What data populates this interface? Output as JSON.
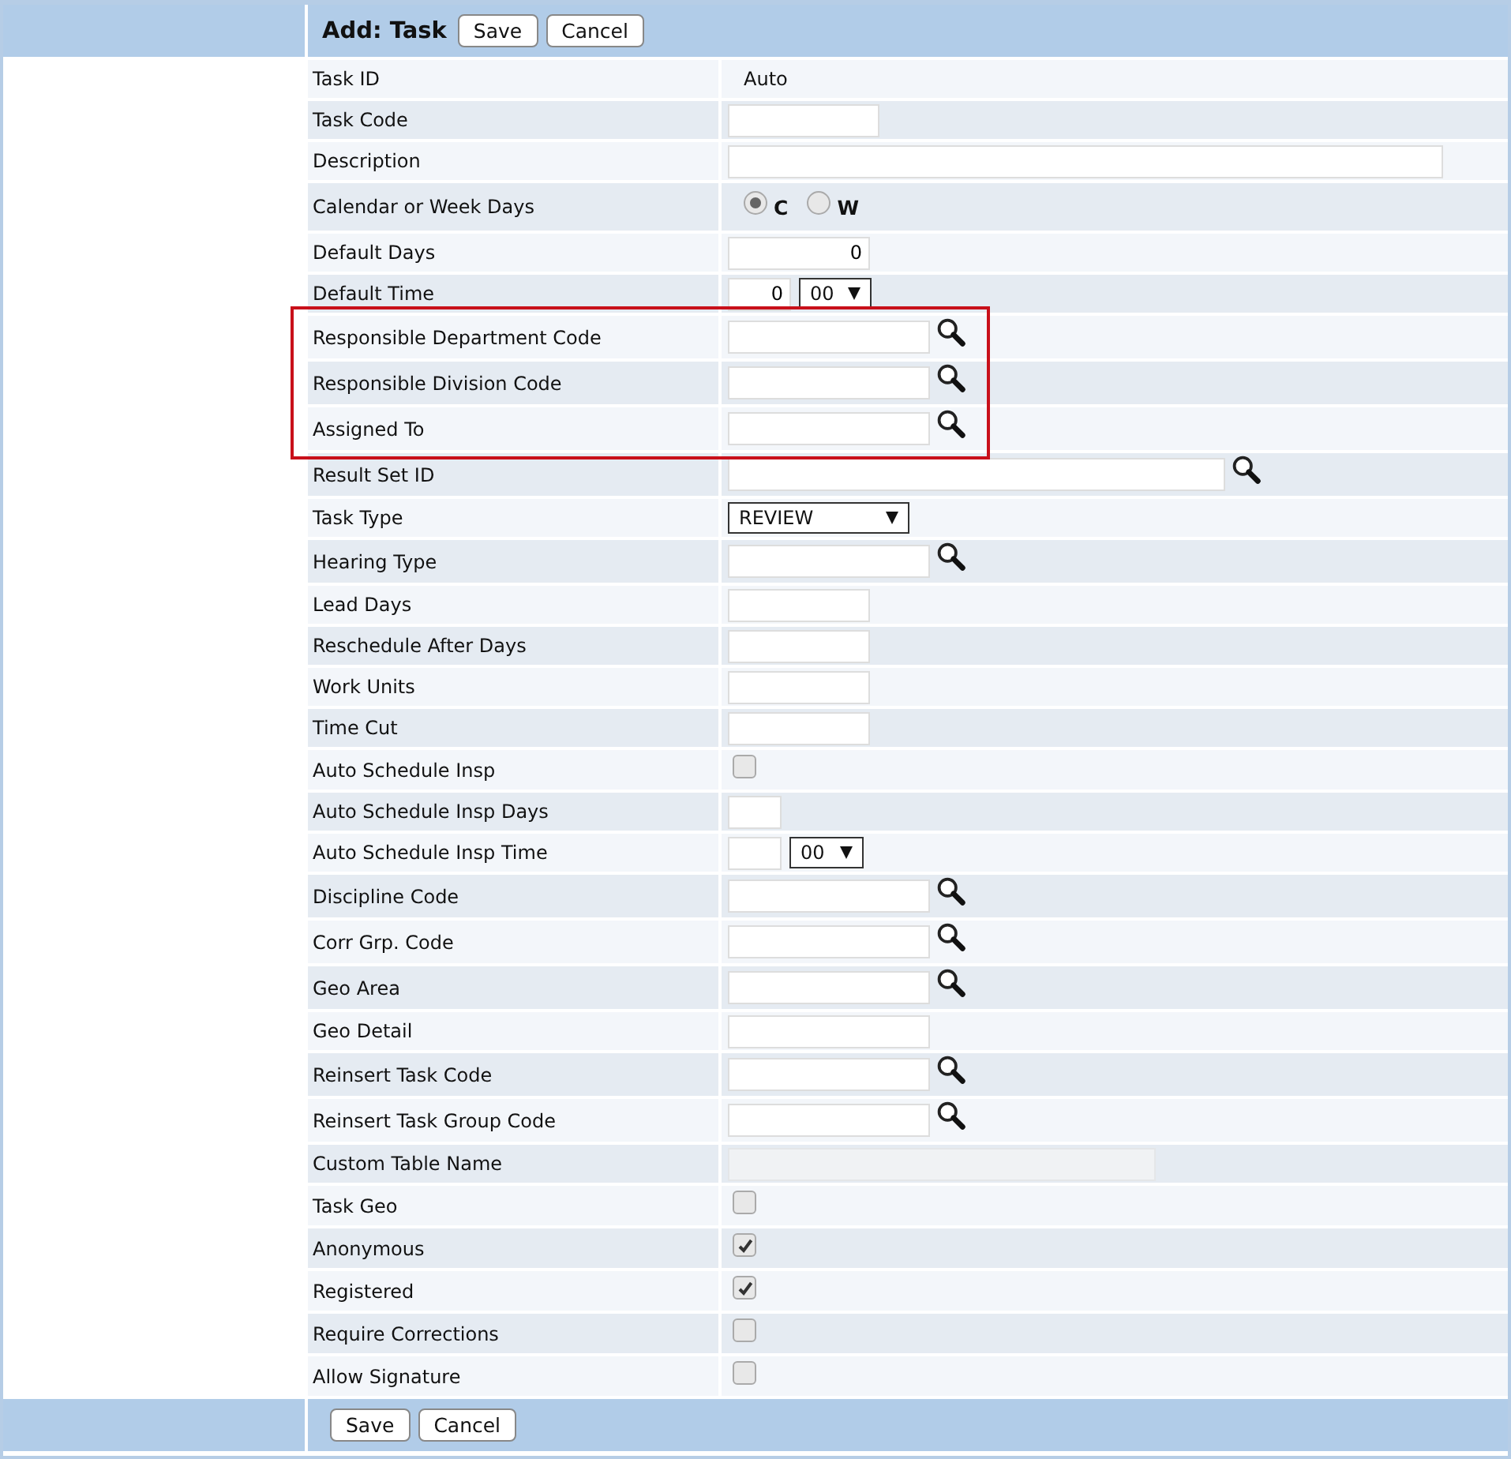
{
  "header": {
    "title": "Add: Task",
    "buttons": [
      "Save",
      "Cancel"
    ]
  },
  "fields": [
    {
      "label": "Task ID",
      "kind": "text",
      "value": "Auto"
    },
    {
      "label": "Task Code",
      "kind": "short"
    },
    {
      "label": "Description",
      "kind": "long"
    },
    {
      "label": "Calendar or Week Days",
      "kind": "radio",
      "options": [
        {
          "label": "C",
          "selected": true
        },
        {
          "label": "W",
          "selected": false
        }
      ]
    },
    {
      "label": "Default Days",
      "kind": "number",
      "value": "0"
    },
    {
      "label": "Default Time",
      "kind": "time",
      "value": "0",
      "select": "00"
    },
    {
      "label": "Responsible Department Code",
      "kind": "lookup",
      "highlighted": true
    },
    {
      "label": "Responsible Division Code",
      "kind": "lookup",
      "highlighted": true
    },
    {
      "label": "Assigned To",
      "kind": "lookup",
      "highlighted": true
    },
    {
      "label": "Result Set ID",
      "kind": "widelookup"
    },
    {
      "label": "Task Type",
      "kind": "select",
      "select": "REVIEW"
    },
    {
      "label": "Hearing Type",
      "kind": "lookup"
    },
    {
      "label": "Lead Days",
      "kind": "short"
    },
    {
      "label": "Reschedule After Days",
      "kind": "short"
    },
    {
      "label": "Work Units",
      "kind": "short"
    },
    {
      "label": "Time Cut",
      "kind": "short"
    },
    {
      "label": "Auto Schedule Insp",
      "kind": "checkbox",
      "checked": false
    },
    {
      "label": "Auto Schedule Insp Days",
      "kind": "tiny"
    },
    {
      "label": "Auto Schedule Insp Time",
      "kind": "time",
      "select": "00"
    },
    {
      "label": "Discipline Code",
      "kind": "lookup"
    },
    {
      "label": "Corr Grp. Code",
      "kind": "lookup"
    },
    {
      "label": "Geo Area",
      "kind": "lookup"
    },
    {
      "label": "Geo Detail",
      "kind": "mid"
    },
    {
      "label": "Reinsert Task Code",
      "kind": "lookup"
    },
    {
      "label": "Reinsert Task Group Code",
      "kind": "lookup"
    },
    {
      "label": "Custom Table Name",
      "kind": "disabled",
      "disabled": true
    },
    {
      "label": "Task Geo",
      "kind": "checkbox",
      "checked": false
    },
    {
      "label": "Anonymous",
      "kind": "checkbox",
      "checked": true
    },
    {
      "label": "Registered",
      "kind": "checkbox",
      "checked": true
    },
    {
      "label": "Require Corrections",
      "kind": "checkbox",
      "checked": false
    },
    {
      "label": "Allow Signature",
      "kind": "checkbox",
      "checked": false
    }
  ],
  "footer": {
    "buttons": [
      "Save",
      "Cancel"
    ]
  }
}
